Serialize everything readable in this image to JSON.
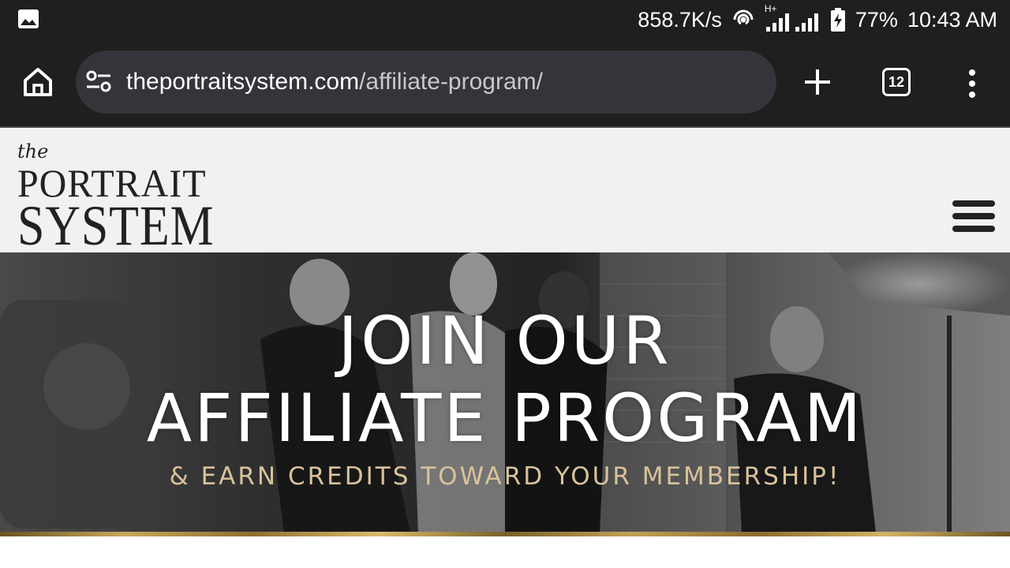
{
  "status_bar": {
    "network_speed": "858.7K/s",
    "network_type": "H+",
    "battery_percent": "77%",
    "time": "10:43 AM",
    "icons": [
      "gallery-icon",
      "hotspot-icon",
      "signal-icon",
      "battery-charging-icon"
    ]
  },
  "browser": {
    "url_domain": "theportraitsystem.com",
    "url_path": "/affiliate-program/",
    "tab_count": "12",
    "icons": [
      "home-icon",
      "site-info-icon",
      "plus-icon",
      "tabs-icon",
      "more-vert-icon"
    ]
  },
  "site_header": {
    "logo_the": "the",
    "logo_line1": "PORTRAIT",
    "logo_line2": "SYSTEM",
    "menu_icon": "hamburger-menu-icon"
  },
  "hero": {
    "title_line1": "JOIN OUR",
    "title_line2": "AFFILIATE PROGRAM",
    "subtitle": "& EARN CREDITS TOWARD YOUR MEMBERSHIP!",
    "subtitle_color": "#d9c29a"
  },
  "colors": {
    "browser_chrome": "#1f1f1f",
    "url_bar": "#34353a",
    "site_header_bg": "#f1f1f1",
    "gold_accent": "#c7a75a"
  }
}
